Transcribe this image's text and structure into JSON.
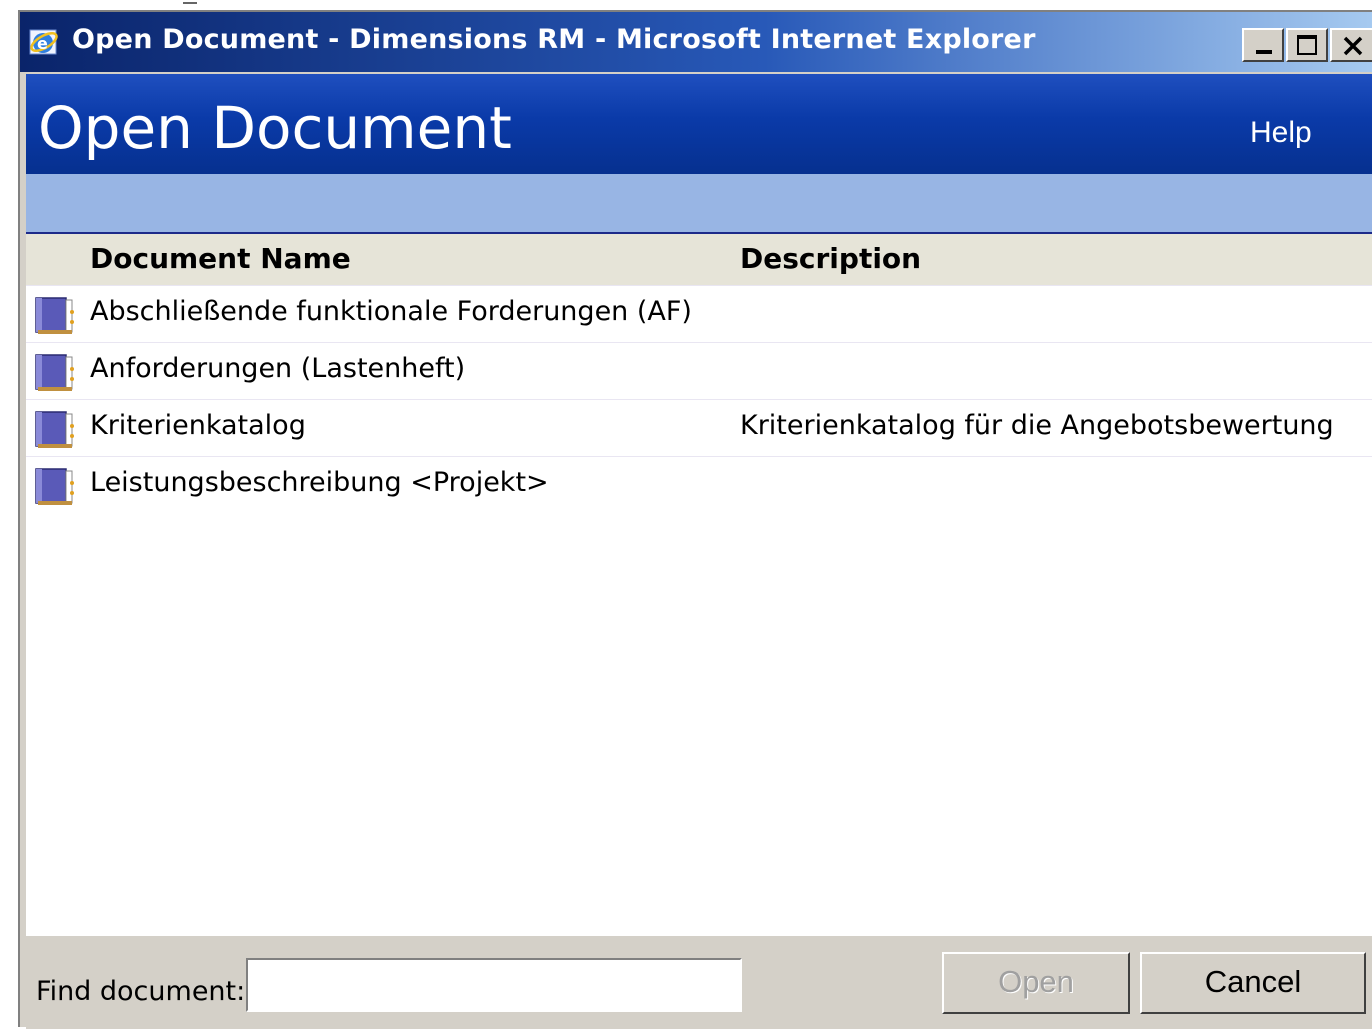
{
  "window": {
    "title": "Open Document - Dimensions RM - Microsoft Internet Explorer",
    "controls": [
      "minimize",
      "maximize",
      "close"
    ]
  },
  "header": {
    "title": "Open Document",
    "help_label": "Help"
  },
  "table": {
    "columns": [
      "Document Name",
      "Description"
    ],
    "rows": [
      {
        "name": "Abschließende funktionale Forderungen (AF)",
        "description": "",
        "icon": "document-icon"
      },
      {
        "name": "Anforderungen (Lastenheft)",
        "description": "",
        "icon": "document-icon"
      },
      {
        "name": "Kriterienkatalog",
        "description": "Kriterienkatalog für die Angebotsbewertung",
        "icon": "document-icon"
      },
      {
        "name": "Leistungsbeschreibung <Projekt>",
        "description": "",
        "icon": "document-icon"
      }
    ]
  },
  "footer": {
    "find_label": "Find document:",
    "find_value": "",
    "open_label": "Open",
    "open_enabled": false,
    "cancel_label": "Cancel"
  },
  "colors": {
    "titlebar_start": "#0a246a",
    "titlebar_end": "#a6caf0",
    "header_band": "#0a3aa8",
    "sub_band": "#98b5e4",
    "table_header": "#e6e4d8",
    "table_border": "#1c2a8a",
    "dialog_face": "#d4d0c8"
  }
}
